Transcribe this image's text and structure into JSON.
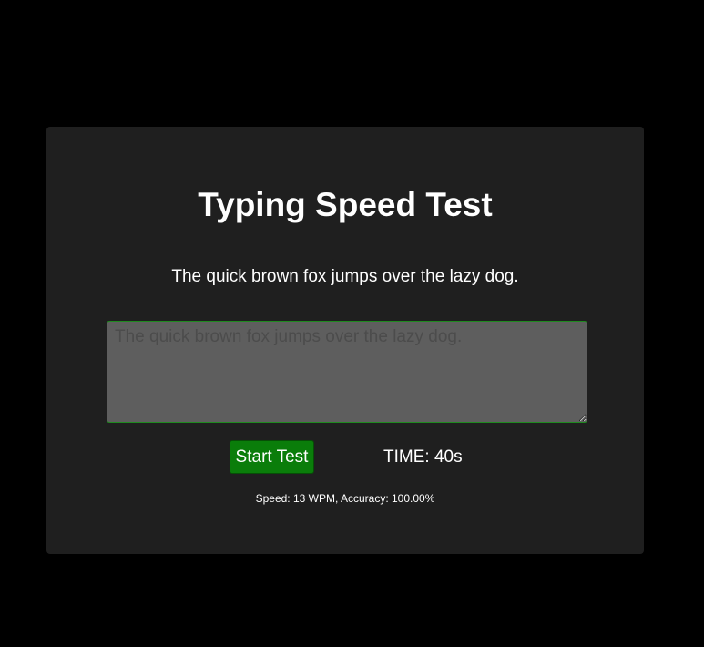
{
  "app": {
    "title": "Typing Speed Test",
    "prompt_text": "The quick brown fox jumps over the lazy dog."
  },
  "input": {
    "value": "",
    "placeholder": "The quick brown fox jumps over the lazy dog."
  },
  "controls": {
    "start_label": "Start Test",
    "timer_text": "TIME: 40s"
  },
  "results": {
    "summary": "Speed: 13 WPM, Accuracy: 100.00%"
  },
  "colors": {
    "page_background": "#000000",
    "card_background": "#1f1f1f",
    "accent_green": "#0a7d0a",
    "input_background": "#5e5e5e"
  }
}
